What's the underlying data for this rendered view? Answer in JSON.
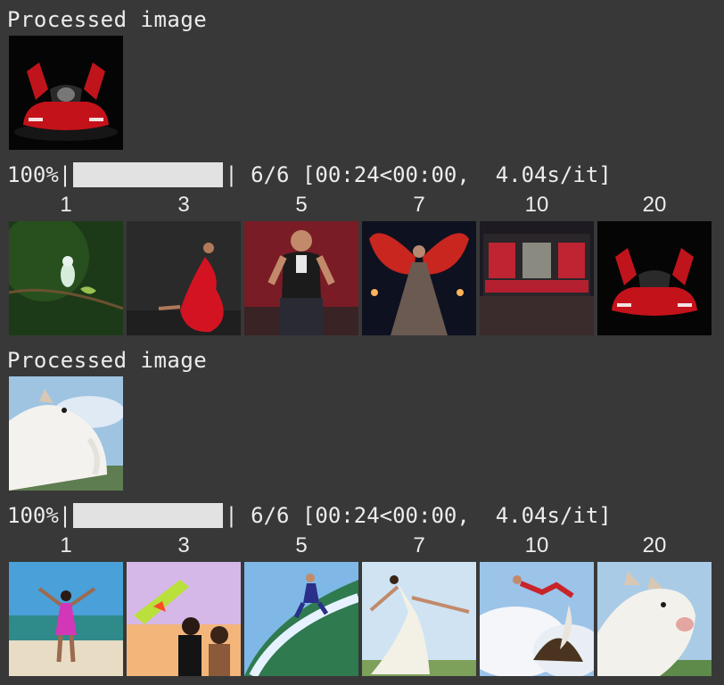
{
  "sections": [
    {
      "title": "Processed image",
      "processed_image": "red-sports-car-doors-open",
      "progress": {
        "percent_text": "100%",
        "fraction": 1.0,
        "status_text": "6/6 [00:24<00:00,  4.04s/it]"
      },
      "steps": [
        {
          "label": "1",
          "image": "bird-on-branch"
        },
        {
          "label": "3",
          "image": "dancer-red-dress"
        },
        {
          "label": "5",
          "image": "man-in-vest-seated"
        },
        {
          "label": "7",
          "image": "woman-red-wings"
        },
        {
          "label": "10",
          "image": "red-building-facade"
        },
        {
          "label": "20",
          "image": "red-sports-car"
        }
      ]
    },
    {
      "title": "Processed image",
      "processed_image": "white-goat",
      "progress": {
        "percent_text": "100%",
        "fraction": 1.0,
        "status_text": "6/6 [00:24<00:00,  4.04s/it]"
      },
      "steps": [
        {
          "label": "1",
          "image": "woman-on-beach"
        },
        {
          "label": "3",
          "image": "couple-and-plane"
        },
        {
          "label": "5",
          "image": "surfer-wave"
        },
        {
          "label": "7",
          "image": "dancer-white-dress"
        },
        {
          "label": "10",
          "image": "jumping-figure-clouds"
        },
        {
          "label": "20",
          "image": "white-goat"
        }
      ]
    }
  ]
}
